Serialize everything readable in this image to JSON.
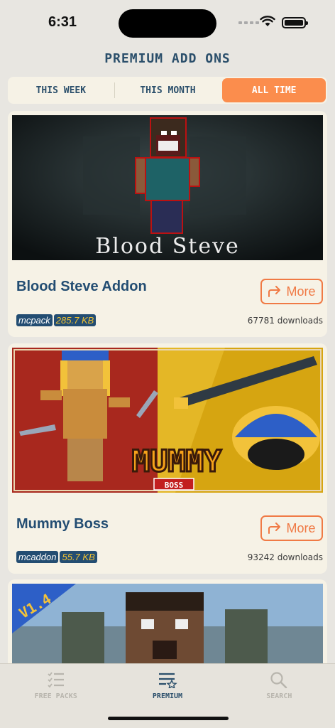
{
  "status": {
    "time": "6:31"
  },
  "header": {
    "title": "PREMIUM ADD ONS"
  },
  "segments": [
    {
      "label": "THIS WEEK",
      "active": false
    },
    {
      "label": "THIS MONTH",
      "active": false
    },
    {
      "label": "ALL TIME",
      "active": true
    }
  ],
  "cards": [
    {
      "thumb_text": "Blood Steve",
      "title": "Blood Steve Addon",
      "more_label": "More",
      "type": "mcpack",
      "size": "285.7 KB",
      "downloads": "67781 downloads"
    },
    {
      "thumb_text": "MUMMY",
      "thumb_badge": "BOSS",
      "title": "Mummy Boss",
      "more_label": "More",
      "type": "mcaddon",
      "size": "55.7 KB",
      "downloads": "93242 downloads"
    },
    {
      "thumb_badge": "V1.4"
    }
  ],
  "tabbar": [
    {
      "label": "FREE PACKS",
      "icon": "checklist-icon",
      "active": false
    },
    {
      "label": "PREMIUM",
      "icon": "list-star-icon",
      "active": true
    },
    {
      "label": "SEARCH",
      "icon": "search-icon",
      "active": false
    }
  ],
  "colors": {
    "accent": "#fb8d4d",
    "primary": "#2b4f6b",
    "card": "#f6f2e6"
  }
}
